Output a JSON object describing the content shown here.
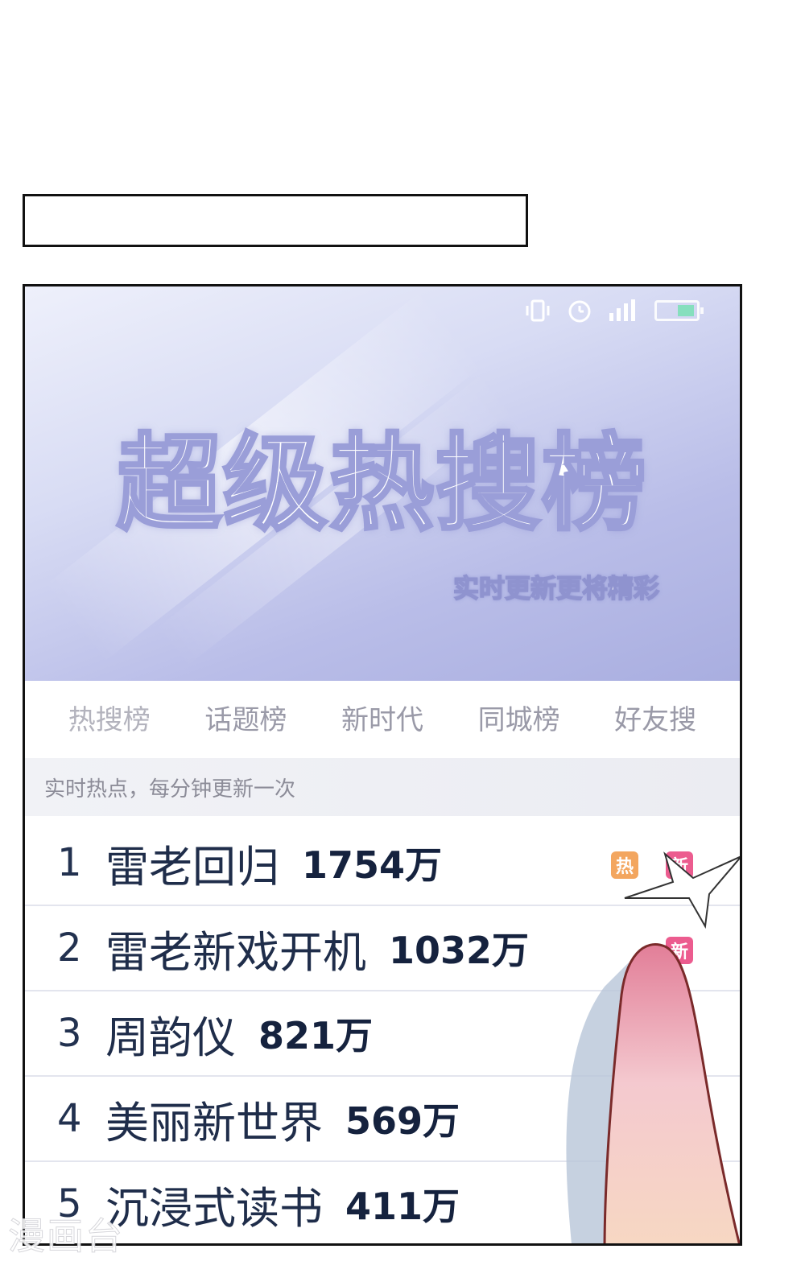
{
  "caption_box": {
    "text": ""
  },
  "banner": {
    "title": "超级热搜榜",
    "subtitle": "实时更新更将精彩",
    "status_icons": [
      "vibrate-icon",
      "alarm-icon",
      "signal-icon",
      "battery-icon"
    ]
  },
  "tabs": [
    {
      "label": "热搜榜",
      "active": true
    },
    {
      "label": "话题榜",
      "active": false
    },
    {
      "label": "新时代",
      "active": false
    },
    {
      "label": "同城榜",
      "active": false
    },
    {
      "label": "好友搜",
      "active": false
    }
  ],
  "hint": "实时热点，每分钟更新一次",
  "items": [
    {
      "rank": "1",
      "title": "雷老回归",
      "heat": "1754万",
      "badges": [
        "热",
        "新"
      ]
    },
    {
      "rank": "2",
      "title": "雷老新戏开机",
      "heat": "1032万",
      "badges": [
        "新"
      ]
    },
    {
      "rank": "3",
      "title": "周韵仪",
      "heat": "821万",
      "badges": []
    },
    {
      "rank": "4",
      "title": "美丽新世界",
      "heat": "569万",
      "badges": []
    },
    {
      "rank": "5",
      "title": "沉浸式读书",
      "heat": "411万",
      "badges": []
    }
  ],
  "watermark": "漫画台",
  "colors": {
    "hot_badge": "#f3a65f",
    "new_badge": "#ec5c8f",
    "accent_underline": "#ec7c4a"
  }
}
